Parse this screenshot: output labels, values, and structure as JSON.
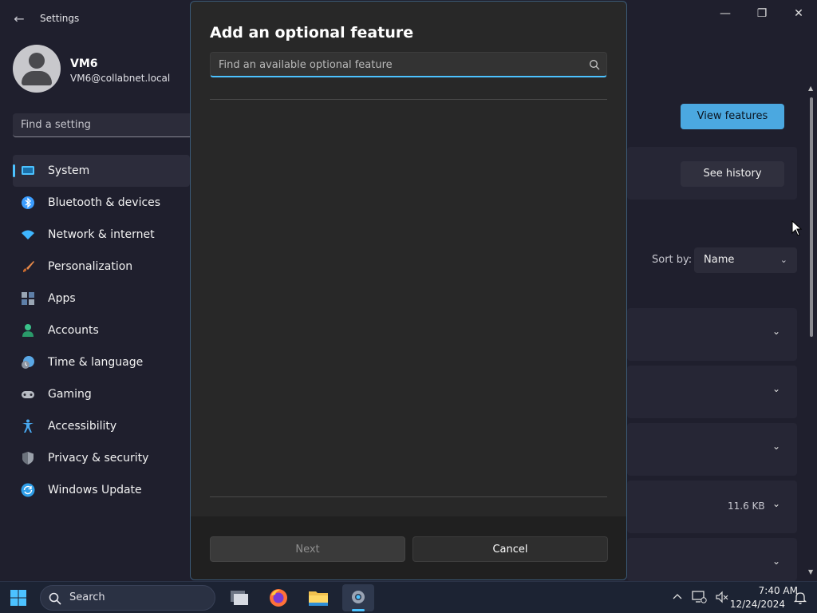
{
  "window": {
    "title": "Settings",
    "back_glyph": "←",
    "controls": {
      "minimize": "—",
      "maximize": "❐",
      "close": "✕"
    }
  },
  "profile": {
    "name": "VM6",
    "email": "VM6@collabnet.local"
  },
  "search": {
    "placeholder": "Find a setting"
  },
  "nav": {
    "items": [
      {
        "label": "System",
        "icon": "system-icon",
        "selected": true,
        "color": "#4cc2ff"
      },
      {
        "label": "Bluetooth & devices",
        "icon": "bluetooth-icon",
        "selected": false,
        "color": "#3b9dff"
      },
      {
        "label": "Network & internet",
        "icon": "wifi-icon",
        "selected": false,
        "color": "#3fb6ff"
      },
      {
        "label": "Personalization",
        "icon": "brush-icon",
        "selected": false,
        "color": "#e6894a"
      },
      {
        "label": "Apps",
        "icon": "apps-icon",
        "selected": false,
        "color": "#9aa6b4"
      },
      {
        "label": "Accounts",
        "icon": "accounts-icon",
        "selected": false,
        "color": "#3ac28a"
      },
      {
        "label": "Time & language",
        "icon": "globe-clock-icon",
        "selected": false,
        "color": "#5aa8e6"
      },
      {
        "label": "Gaming",
        "icon": "gamepad-icon",
        "selected": false,
        "color": "#b8bcc4"
      },
      {
        "label": "Accessibility",
        "icon": "accessibility-icon",
        "selected": false,
        "color": "#48a8f0"
      },
      {
        "label": "Privacy & security",
        "icon": "shield-icon",
        "selected": false,
        "color": "#9aa0aa"
      },
      {
        "label": "Windows Update",
        "icon": "update-icon",
        "selected": false,
        "color": "#2f9ee8"
      }
    ]
  },
  "main": {
    "view_features_label": "View features",
    "see_history_label": "See history",
    "sort_by_label": "Sort by:",
    "sort_value": "Name",
    "feature_sizes": [
      "",
      "",
      "",
      "11.6 KB",
      ""
    ]
  },
  "dialog": {
    "title": "Add an optional feature",
    "search_placeholder": "Find an available optional feature",
    "next_label": "Next",
    "cancel_label": "Cancel"
  },
  "taskbar": {
    "search_label": "Search",
    "apps": [
      "task-view-icon",
      "firefox-icon",
      "file-explorer-icon",
      "settings-app-icon"
    ],
    "time": "7:40 AM",
    "date": "12/24/2024"
  },
  "colors": {
    "accent": "#4cc2ff",
    "primary_button": "#4ba8e0",
    "dialog_bg": "#282828",
    "window_bg": "#1f1f2d",
    "taskbar_bg": "#1c2333"
  }
}
